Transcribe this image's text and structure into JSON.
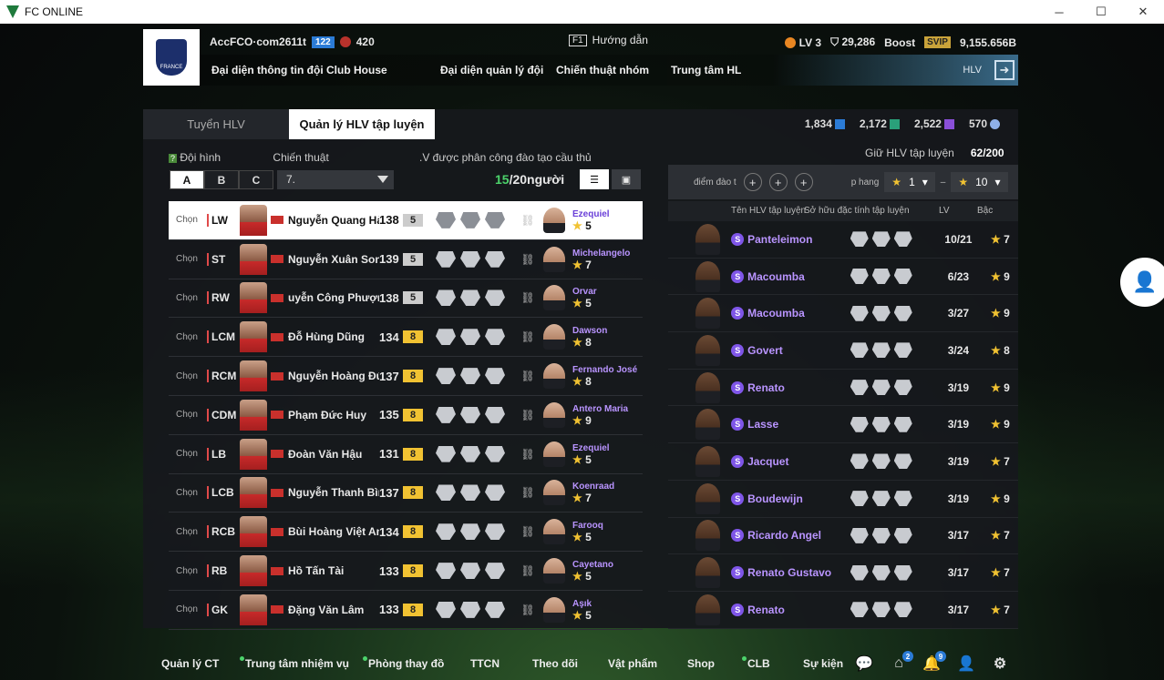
{
  "window": {
    "title": "FC ONLINE",
    "minimize": "─",
    "maximize": "☐",
    "close": "✕"
  },
  "account": {
    "name": "AccFCO·com2611t",
    "level_badge": "122",
    "trophies": "420"
  },
  "help": {
    "key": "F1",
    "label": "Hướng dẫn"
  },
  "stats": {
    "lv": "LV 3",
    "points": "29,286",
    "boost": "Boost",
    "svip": "SVIP",
    "bp": "9,155.656B"
  },
  "nav": [
    "Đại diện thông tin đội",
    "Club House",
    "Đại diện quản lý đội",
    "Chiến thuật nhóm",
    "Trung tâm HL"
  ],
  "hlv_label": "HLV",
  "tabs": [
    "Tuyển HLV",
    "Quản lý HLV tập luyện"
  ],
  "currencies": [
    {
      "value": "1,834",
      "color": "#2b7bd6"
    },
    {
      "value": "2,172",
      "color": "#2aa07a"
    },
    {
      "value": "2,522",
      "color": "#8a4fd8"
    },
    {
      "value": "570",
      "color": "#8fb0e8"
    }
  ],
  "filters": {
    "formation_label": "Đội hình",
    "formation_buttons": [
      "A",
      "B",
      "C"
    ],
    "tactic_label": "Chiến thuật",
    "tactic_value": "7.",
    "assign_label": ".V được phân công đào tạo cầu thủ",
    "assigned": "15",
    "assigned_total": "/20người"
  },
  "players": [
    {
      "chon": "Chọn",
      "pos": "LW",
      "name": "Nguyễn Quang Hải",
      "ovr": "138",
      "grade": "5",
      "coach": "Ezequiel",
      "coach_star": "5"
    },
    {
      "chon": "Chọn",
      "pos": "ST",
      "name": "Nguyễn Xuân Son",
      "ovr": "139",
      "grade": "5",
      "coach": "Michelangelo",
      "coach_star": "7"
    },
    {
      "chon": "Chọn",
      "pos": "RW",
      "name": "uyễn Công Phượng",
      "ovr": "138",
      "grade": "5",
      "coach": "Orvar",
      "coach_star": "5"
    },
    {
      "chon": "Chọn",
      "pos": "LCM",
      "name": "Đỗ Hùng Dũng",
      "ovr": "134",
      "grade": "8",
      "coach": "Dawson",
      "coach_star": "8"
    },
    {
      "chon": "Chọn",
      "pos": "RCM",
      "name": "Nguyễn Hoàng Đức",
      "ovr": "137",
      "grade": "8",
      "coach": "Fernando José",
      "coach_star": "8"
    },
    {
      "chon": "Chọn",
      "pos": "CDM",
      "name": "Phạm Đức Huy",
      "ovr": "135",
      "grade": "8",
      "coach": "Antero Maria",
      "coach_star": "9"
    },
    {
      "chon": "Chọn",
      "pos": "LB",
      "name": "Đoàn Văn Hậu",
      "ovr": "131",
      "grade": "8",
      "coach": "Ezequiel",
      "coach_star": "5"
    },
    {
      "chon": "Chọn",
      "pos": "LCB",
      "name": "Nguyễn Thanh Bình",
      "ovr": "137",
      "grade": "8",
      "coach": "Koenraad",
      "coach_star": "7"
    },
    {
      "chon": "Chọn",
      "pos": "RCB",
      "name": "Bùi Hoàng Việt Anh",
      "ovr": "134",
      "grade": "8",
      "coach": "Farooq",
      "coach_star": "5"
    },
    {
      "chon": "Chọn",
      "pos": "RB",
      "name": "Hồ Tấn Tài",
      "ovr": "133",
      "grade": "8",
      "coach": "Cayetano",
      "coach_star": "5"
    },
    {
      "chon": "Chọn",
      "pos": "GK",
      "name": "Đặng Văn Lâm",
      "ovr": "133",
      "grade": "8",
      "coach": "Aşık",
      "coach_star": "5"
    }
  ],
  "right": {
    "keep_label": "Giữ HLV tập luyện",
    "keep_value": "62/200",
    "filter_label": "điểm đào t",
    "rank_label": "p hang",
    "rank_from": "1",
    "rank_to": "10",
    "col_name": "Tên HLV tập luyện",
    "col_trait": "Sở hữu đặc tính tập luyện",
    "col_lv": "LV",
    "col_bac": "Bậc"
  },
  "coaches": [
    {
      "name": "Panteleimon",
      "lv": "10/21",
      "bac": "7"
    },
    {
      "name": "Macoumba",
      "lv": "6/23",
      "bac": "9"
    },
    {
      "name": "Macoumba",
      "lv": "3/27",
      "bac": "9"
    },
    {
      "name": "Govert",
      "lv": "3/24",
      "bac": "8"
    },
    {
      "name": "Renato",
      "lv": "3/19",
      "bac": "9"
    },
    {
      "name": "Lasse",
      "lv": "3/19",
      "bac": "9"
    },
    {
      "name": "Jacquet",
      "lv": "3/19",
      "bac": "7"
    },
    {
      "name": "Boudewijn",
      "lv": "3/19",
      "bac": "9"
    },
    {
      "name": "Ricardo Angel",
      "lv": "3/17",
      "bac": "7"
    },
    {
      "name": "Renato Gustavo",
      "lv": "3/17",
      "bac": "7"
    },
    {
      "name": "Renato",
      "lv": "3/17",
      "bac": "7"
    }
  ],
  "bottom": [
    "Quản lý CT",
    "Trung tâm nhiệm vụ",
    "Phòng thay đồ",
    "TTCN",
    "Theo dõi",
    "Vật phẩm",
    "Shop",
    "CLB",
    "Sự kiện"
  ],
  "badges": {
    "home": "2",
    "bell": "9"
  }
}
